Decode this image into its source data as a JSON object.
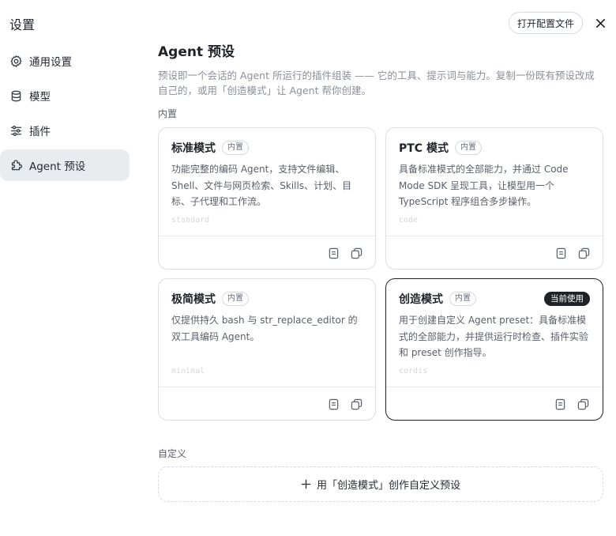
{
  "sidebar": {
    "title": "设置",
    "items": [
      {
        "label": "通用设置",
        "icon": "gear-icon",
        "active": false
      },
      {
        "label": "模型",
        "icon": "database-icon",
        "active": false
      },
      {
        "label": "插件",
        "icon": "sliders-icon",
        "active": false
      },
      {
        "label": "Agent 预设",
        "icon": "preset-icon",
        "active": true
      }
    ]
  },
  "header": {
    "open_config_label": "打开配置文件",
    "close_icon": "close-icon"
  },
  "main": {
    "title": "Agent 预设",
    "description": "预设即一个会话的 Agent 所运行的插件组装 —— 它的工具、提示词与能力。复制一份既有预设改成自己的，或用「创造模式」让 Agent 帮你创建。",
    "builtin_label": "内置",
    "custom_label": "自定义",
    "presets": [
      {
        "name": "标准模式",
        "badge": "内置",
        "description": "功能完整的编码 Agent，支持文件编辑、Shell、文件与网页检索、Skills、计划、目标、子代理和工作流。",
        "id": "standard",
        "current": false
      },
      {
        "name": "PTC 模式",
        "badge": "内置",
        "description": "具备标准模式的全部能力，并通过 Code Mode SDK 呈现工具，让模型用一个 TypeScript 程序组合多步操作。",
        "id": "code",
        "current": false
      },
      {
        "name": "极简模式",
        "badge": "内置",
        "description": "仅提供持久 bash 与 str_replace_editor 的双工具编码 Agent。",
        "id": "minimal",
        "current": false
      },
      {
        "name": "创造模式",
        "badge": "内置",
        "description": "用于创建自定义 Agent preset：具备标准模式的全部能力，并提供运行时检查、插件实验和 preset 创作指导。",
        "id": "cordis",
        "current": true,
        "current_label": "当前使用"
      }
    ],
    "create_custom_label": "用「创造模式」创作自定义预设"
  },
  "colors": {
    "text": "#1f2328",
    "muted": "#8a8f96",
    "active_nav_bg": "#e9ecef",
    "border": "#dcdfe3",
    "current_badge_bg": "#1f2328"
  }
}
